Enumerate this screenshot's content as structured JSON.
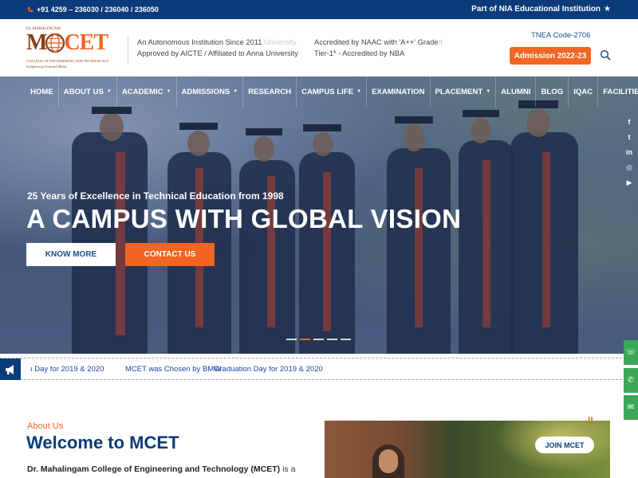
{
  "topbar": {
    "phone": "+91 4259 – 236030 / 236040 / 236050",
    "affiliation": "Part of NIA Educational Institution"
  },
  "logo": {
    "small_top": "Dr. MAHALINGAM",
    "mark_m": "M",
    "mark_cet": "CET",
    "subtitle": "COLLEGE OF ENGINEERING AND TECHNOLOGY",
    "tagline": "Enlightening Technical Minds"
  },
  "header": {
    "info1_line1": "An Autonomous Institution Since 2011",
    "info1_ghost": " University",
    "info1_line2": "Approved by AICTE / Affiliated to Anna University",
    "info2_line1": "Accredited by NAAC with 'A++' Grade",
    "info2_ghost": "d",
    "info2_line2": "Tier-1* - Accredited by NBA",
    "tnea": "TNEA Code-2706",
    "admission": "Admission 2022-23"
  },
  "nav": {
    "items": [
      {
        "label": "HOME",
        "dropdown": false
      },
      {
        "label": "ABOUT US",
        "dropdown": true
      },
      {
        "label": "ACADEMIC",
        "dropdown": true
      },
      {
        "label": "ADMISSIONS",
        "dropdown": true
      },
      {
        "label": "RESEARCH",
        "dropdown": false
      },
      {
        "label": "CAMPUS LIFE",
        "dropdown": true
      },
      {
        "label": "EXAMINATION",
        "dropdown": false
      },
      {
        "label": "PLACEMENT",
        "dropdown": true
      },
      {
        "label": "ALUMNI",
        "dropdown": false
      },
      {
        "label": "BLOG",
        "dropdown": false
      },
      {
        "label": "IQAC",
        "dropdown": false
      },
      {
        "label": "FACILITIES",
        "dropdown": true
      }
    ],
    "caret": "▼"
  },
  "hero": {
    "subtitle": "25 Years of Excellence in Technical Education from 1998",
    "title": "A CAMPUS WITH GLOBAL VISION",
    "know_more": "KNOW MORE",
    "contact": "CONTACT US",
    "slide_count": 5,
    "active_slide": 1
  },
  "social": {
    "icons": [
      "facebook-icon",
      "twitter-icon",
      "linkedin-icon",
      "instagram-icon",
      "youtube-icon"
    ],
    "glyphs": [
      "f",
      "t",
      "in",
      "◎",
      "▶"
    ]
  },
  "ticker": {
    "items": [
      "ı Day for 2019 & 2020",
      "MCET was Chosen by BMW",
      "Graduation Day for 2019 & 2020"
    ]
  },
  "floating": {
    "glyphs": [
      "☏",
      "✆",
      "✉"
    ]
  },
  "about": {
    "label": "About Us",
    "title": "Welcome to MCET",
    "intro_bold": "Dr. Mahalingam College of Engineering and Technology (MCET)",
    "intro_rest": " is a",
    "join": "JOIN MCET",
    "pause": "II"
  },
  "colors": {
    "primary": "#0b3b7a",
    "accent": "#f26522",
    "whatsapp": "#3aa856"
  }
}
